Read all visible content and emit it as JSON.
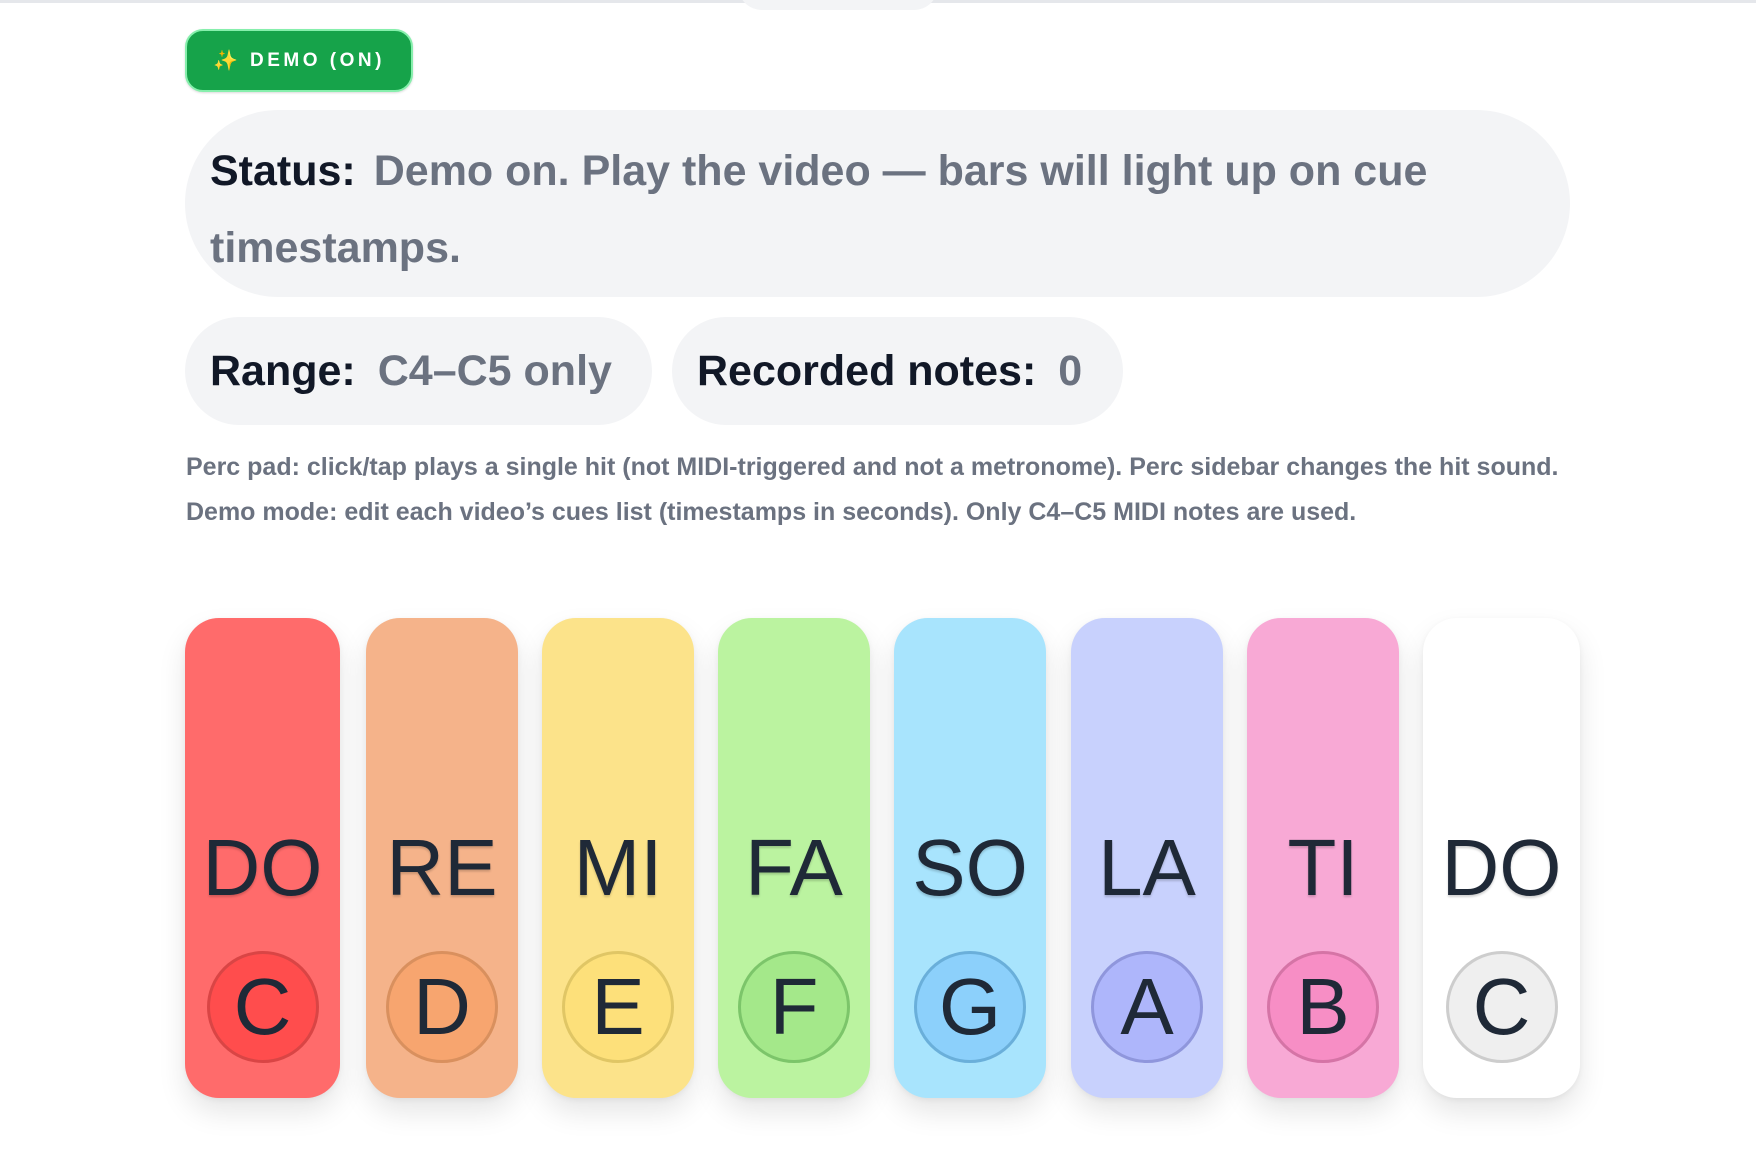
{
  "demo_button": {
    "icon": "sparkles-icon",
    "sparkle": "✨",
    "label": "DEMO (ON)"
  },
  "status": {
    "label": "Status:",
    "value": "Demo on. Play the video — bars will light up on cue timestamps."
  },
  "range": {
    "label": "Range:",
    "value": "C4–C5 only"
  },
  "recorded": {
    "label": "Recorded notes:",
    "value": "0"
  },
  "help": {
    "perc": "Perc pad: click/tap plays a single hit (not MIDI-triggered and not a metronome). Perc sidebar changes the hit sound.",
    "demo": "Demo mode: edit each video’s cues list (timestamps in seconds). Only C4–C5 MIDI notes are used."
  },
  "bars": [
    {
      "solfege": "DO",
      "note": "C",
      "color": "#ff6b6b",
      "circle_color": "#ff4d4d",
      "circle_border": "#d94545"
    },
    {
      "solfege": "RE",
      "note": "D",
      "color": "#f5b38a",
      "circle_color": "#f7a56f",
      "circle_border": "#d9905e"
    },
    {
      "solfege": "MI",
      "note": "E",
      "color": "#fce38a",
      "circle_color": "#fde07a",
      "circle_border": "#e0c665"
    },
    {
      "solfege": "FA",
      "note": "F",
      "color": "#bbf3a0",
      "circle_color": "#a4e88a",
      "circle_border": "#7cc56a"
    },
    {
      "solfege": "SO",
      "note": "G",
      "color": "#a8e4fd",
      "circle_color": "#8cd0fb",
      "circle_border": "#6aafda"
    },
    {
      "solfege": "LA",
      "note": "A",
      "color": "#c8d1fd",
      "circle_color": "#aeb6fb",
      "circle_border": "#8f96dc"
    },
    {
      "solfege": "TI",
      "note": "B",
      "color": "#f8a9d5",
      "circle_color": "#f78ec5",
      "circle_border": "#d574a6"
    },
    {
      "solfege": "DO",
      "note": "C",
      "color": "#ffffff",
      "circle_color": "#efefef",
      "circle_border": "#cdcdcd"
    }
  ]
}
